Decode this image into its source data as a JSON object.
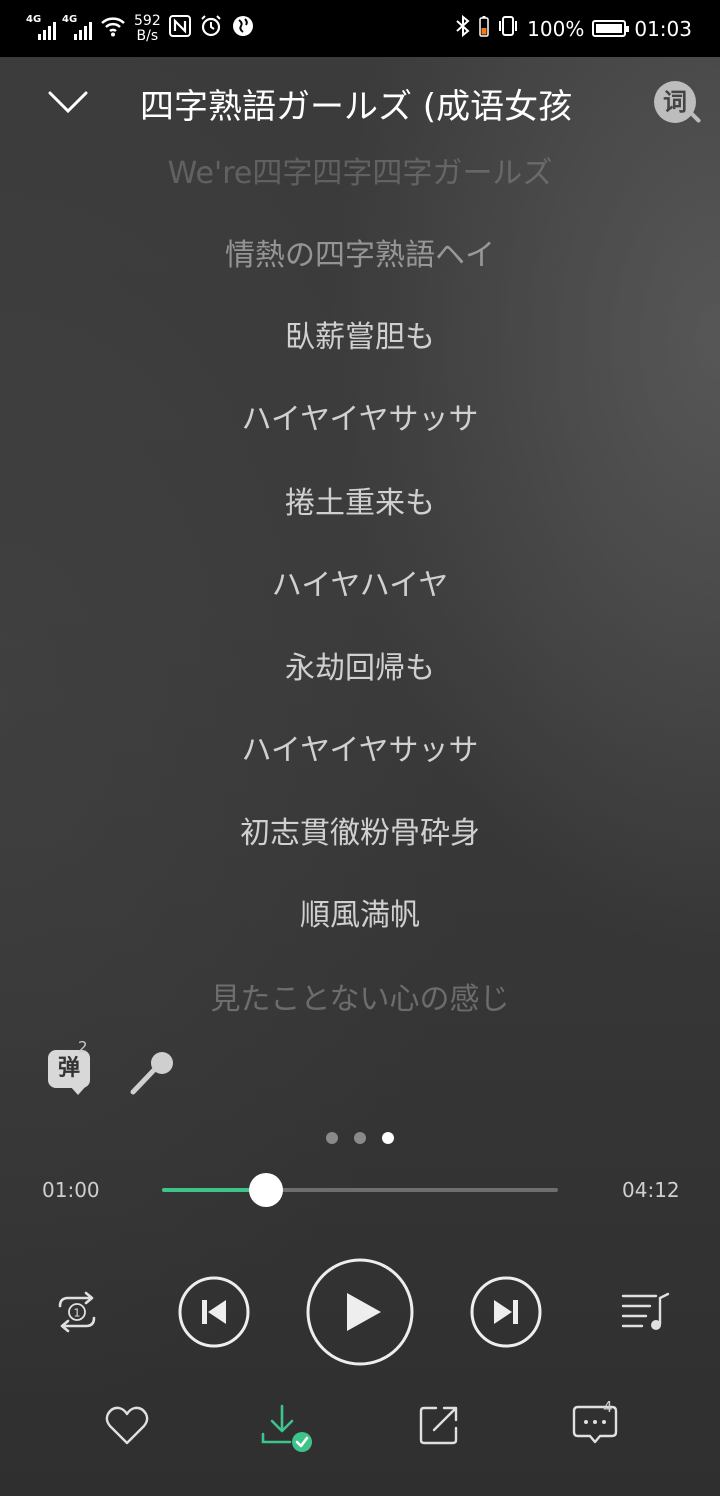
{
  "status_bar": {
    "net1": "4G",
    "net2": "4G",
    "speed_value": "592",
    "speed_unit": "B/s",
    "battery_percent": "100%",
    "time": "01:03"
  },
  "header": {
    "title": "四字熟語ガールズ (成语女孩",
    "lyric_search_label": "词"
  },
  "lyrics": [
    "We're四字四字四字ガールズ",
    "情熱の四字熟語ヘイ",
    "臥薪嘗胆も",
    "ハイヤイヤサッサ",
    "捲土重来も",
    "ハイヤハイヤ",
    "永劫回帰も",
    "ハイヤイヤサッサ",
    "初志貫徹粉骨砕身",
    "順風満帆",
    "見たことない心の感じ"
  ],
  "tools": {
    "danmu_label": "弹",
    "danmu_count": "2"
  },
  "pager": {
    "count": 3,
    "active_index": 2
  },
  "player": {
    "current_time": "01:00",
    "total_time": "04:12",
    "progress": 0.262
  },
  "bottom": {
    "comment_count": "4"
  },
  "colors": {
    "accent": "#3ec38a",
    "status_bar_bg": "#000000"
  }
}
